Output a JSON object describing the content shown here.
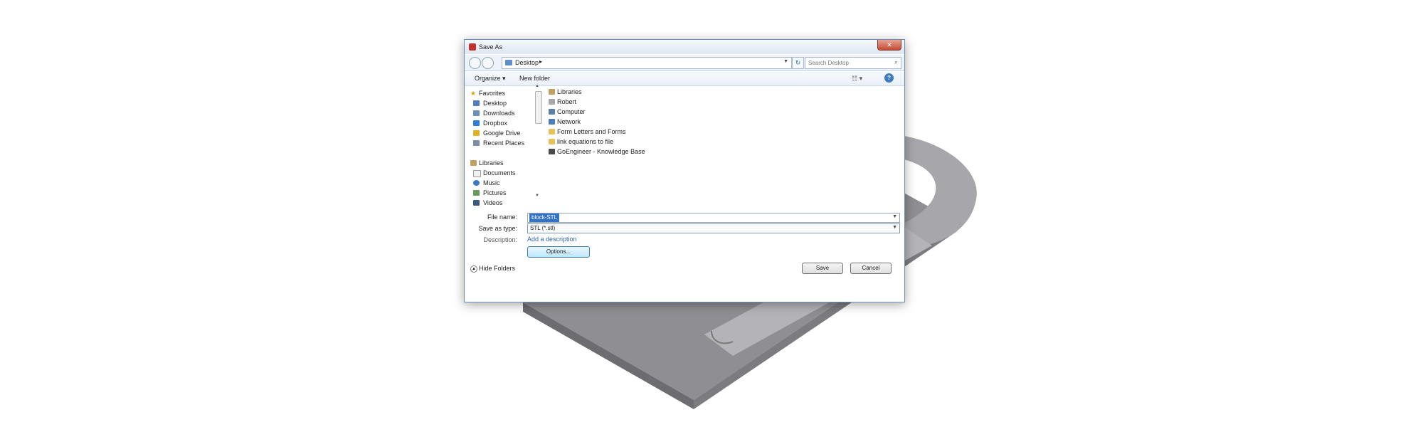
{
  "dialog": {
    "title": "Save As",
    "close_glyph": "✕"
  },
  "address_bar": {
    "location": "Desktop",
    "search_placeholder": "Search Desktop"
  },
  "toolbar": {
    "organize_label": "Organize ▾",
    "new_folder_label": "New folder",
    "views_glyph": "☷ ▾",
    "help_glyph": "?"
  },
  "nav_pane": {
    "favorites_label": "Favorites",
    "favorites": [
      "Desktop",
      "Downloads",
      "Dropbox",
      "Google Drive",
      "Recent Places"
    ],
    "libraries_label": "Libraries",
    "libraries": [
      "Documents",
      "Music",
      "Pictures",
      "Videos"
    ]
  },
  "content": {
    "items": [
      "Libraries",
      "Robert",
      "Computer",
      "Network",
      "Form Letters and Forms",
      "link equations to file",
      "GoEngineer - Knowledge Base"
    ]
  },
  "form": {
    "file_name_label": "File name:",
    "file_name_value": "block-STL",
    "save_as_type_label": "Save as type:",
    "save_as_type_value": "STL (*.stl)",
    "description_label": "Description:",
    "description_link": "Add a description"
  },
  "buttons": {
    "options": "Options...",
    "save": "Save",
    "cancel": "Cancel",
    "hide_folders": "Hide Folders"
  },
  "colors": {
    "selection": "#3372c4",
    "link": "#3164a8",
    "accent_border": "#6e8fb5"
  }
}
